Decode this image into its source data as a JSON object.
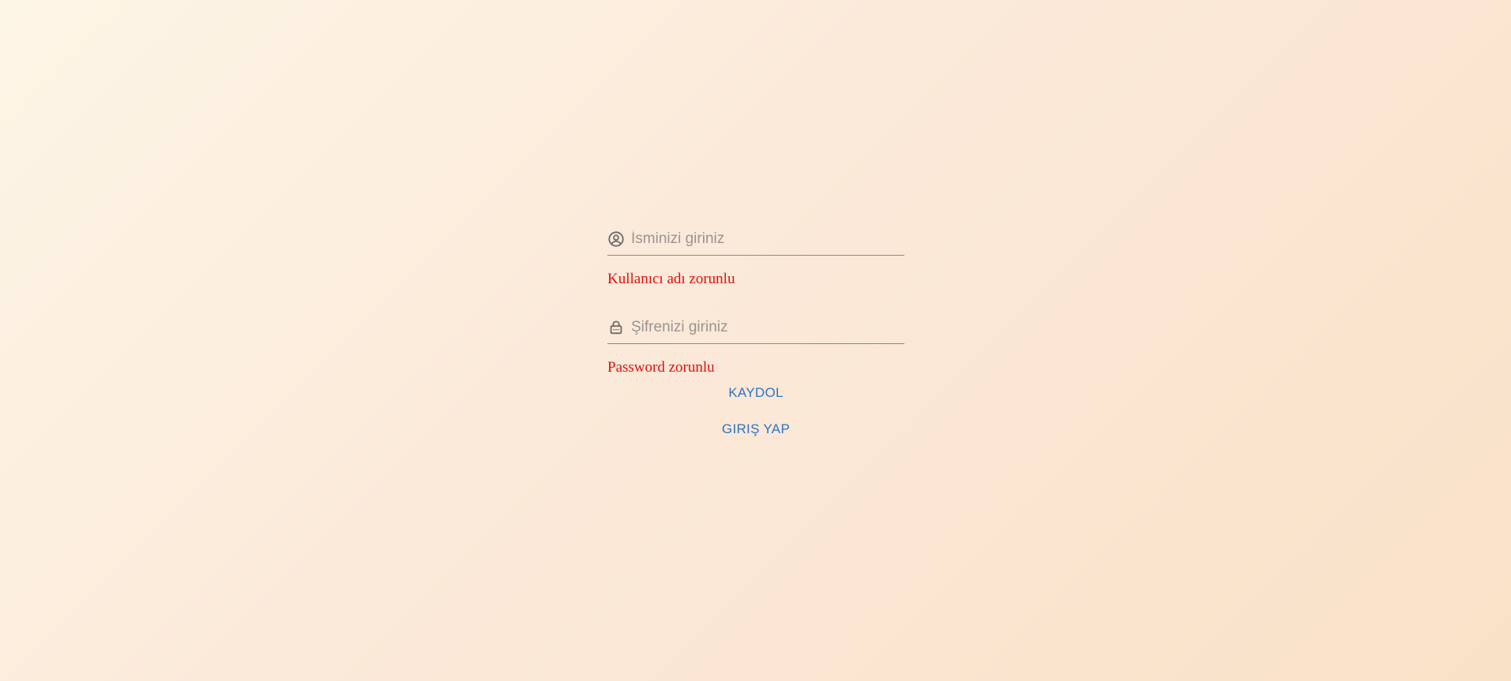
{
  "form": {
    "username": {
      "value": "",
      "placeholder": "İsminizi giriniz",
      "icon": "user-circle-icon",
      "error": "Kullanıcı adı zorunlu"
    },
    "password": {
      "value": "",
      "placeholder": "Şifrenizi giriniz",
      "icon": "lock-icon",
      "error": "Password zorunlu"
    },
    "signup_label": "KAYDOL",
    "login_label": "GIRIŞ YAP"
  },
  "colors": {
    "error": "#e01010",
    "accent": "#2f73c4",
    "background_start": "#fdf5e6",
    "background_end": "#f9e1c7"
  }
}
